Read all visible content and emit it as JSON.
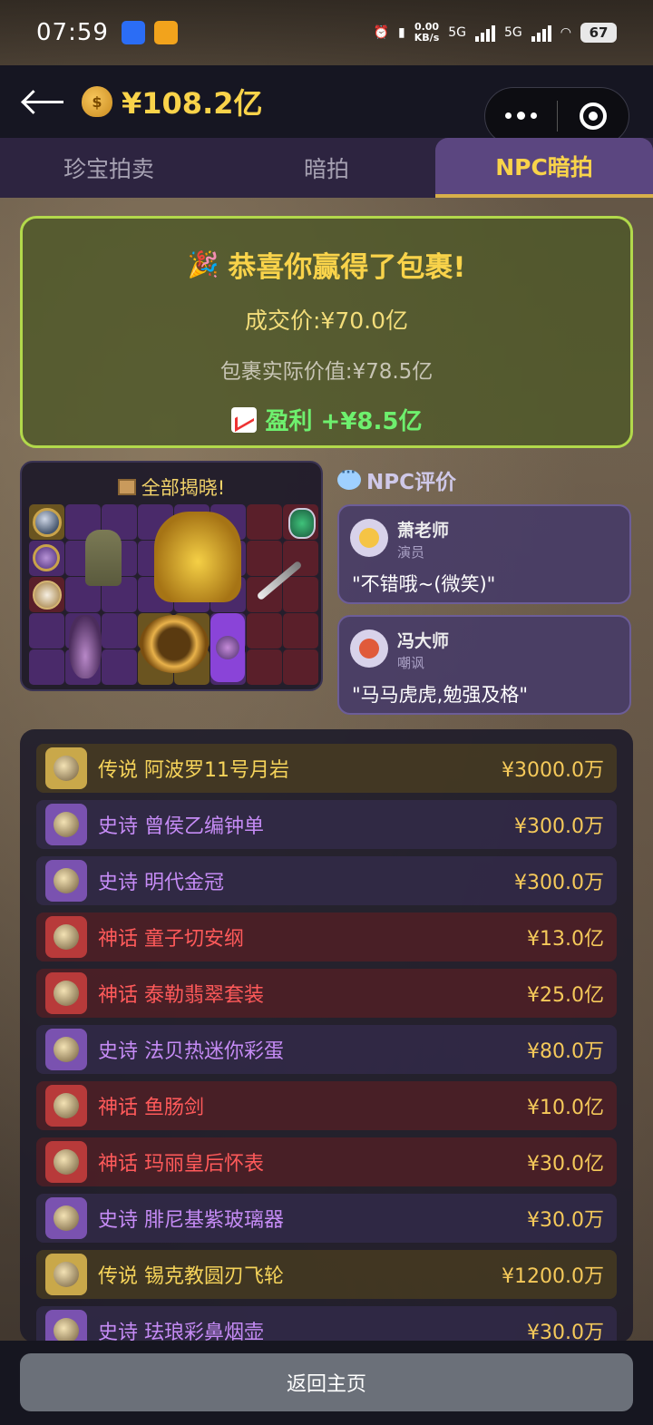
{
  "status_bar": {
    "time": "07:59",
    "net_speed_value": "0.00",
    "net_speed_unit": "KB/s",
    "signal_1": "5G",
    "signal_2": "5G",
    "battery": "67"
  },
  "header": {
    "balance": "¥108.2亿",
    "icons": [
      "back-arrow-icon",
      "money-bag-icon",
      "more-icon",
      "target-icon"
    ]
  },
  "tabs": [
    {
      "label": "珍宝拍卖",
      "active": false
    },
    {
      "label": "暗拍",
      "active": false
    },
    {
      "label": "NPC暗拍",
      "active": true
    }
  ],
  "result": {
    "title": "恭喜你赢得了包裹!",
    "deal_price": "成交价:¥70.0亿",
    "real_value": "包裹实际价值:¥78.5亿",
    "profit": "盈利 +¥8.5亿"
  },
  "reveal": {
    "title": "全部揭晓!"
  },
  "npc": {
    "header": "NPC评价",
    "reviews": [
      {
        "name": "萧老师",
        "role": "演员",
        "quote": "\"不错哦~(微笑)\""
      },
      {
        "name": "冯大师",
        "role": "嘲讽",
        "quote": "\"马马虎虎,勉强及格\""
      }
    ]
  },
  "items": [
    {
      "rarity": "legend",
      "name": "传说 阿波罗11号月岩",
      "price": "¥3000.0万"
    },
    {
      "rarity": "epic",
      "name": "史诗 曾侯乙编钟单",
      "price": "¥300.0万"
    },
    {
      "rarity": "epic",
      "name": "史诗 明代金冠",
      "price": "¥300.0万"
    },
    {
      "rarity": "myth",
      "name": "神话 童子切安纲",
      "price": "¥13.0亿"
    },
    {
      "rarity": "myth",
      "name": "神话 泰勒翡翠套装",
      "price": "¥25.0亿"
    },
    {
      "rarity": "epic",
      "name": "史诗 法贝热迷你彩蛋",
      "price": "¥80.0万"
    },
    {
      "rarity": "myth",
      "name": "神话 鱼肠剑",
      "price": "¥10.0亿"
    },
    {
      "rarity": "myth",
      "name": "神话 玛丽皇后怀表",
      "price": "¥30.0亿"
    },
    {
      "rarity": "epic",
      "name": "史诗 腓尼基紫玻璃器",
      "price": "¥30.0万"
    },
    {
      "rarity": "legend",
      "name": "传说 锡克教圆刃飞轮",
      "price": "¥1200.0万"
    },
    {
      "rarity": "epic",
      "name": "史诗 珐琅彩鼻烟壶",
      "price": "¥30.0万"
    }
  ],
  "bottom": {
    "home_button": "返回主页"
  }
}
